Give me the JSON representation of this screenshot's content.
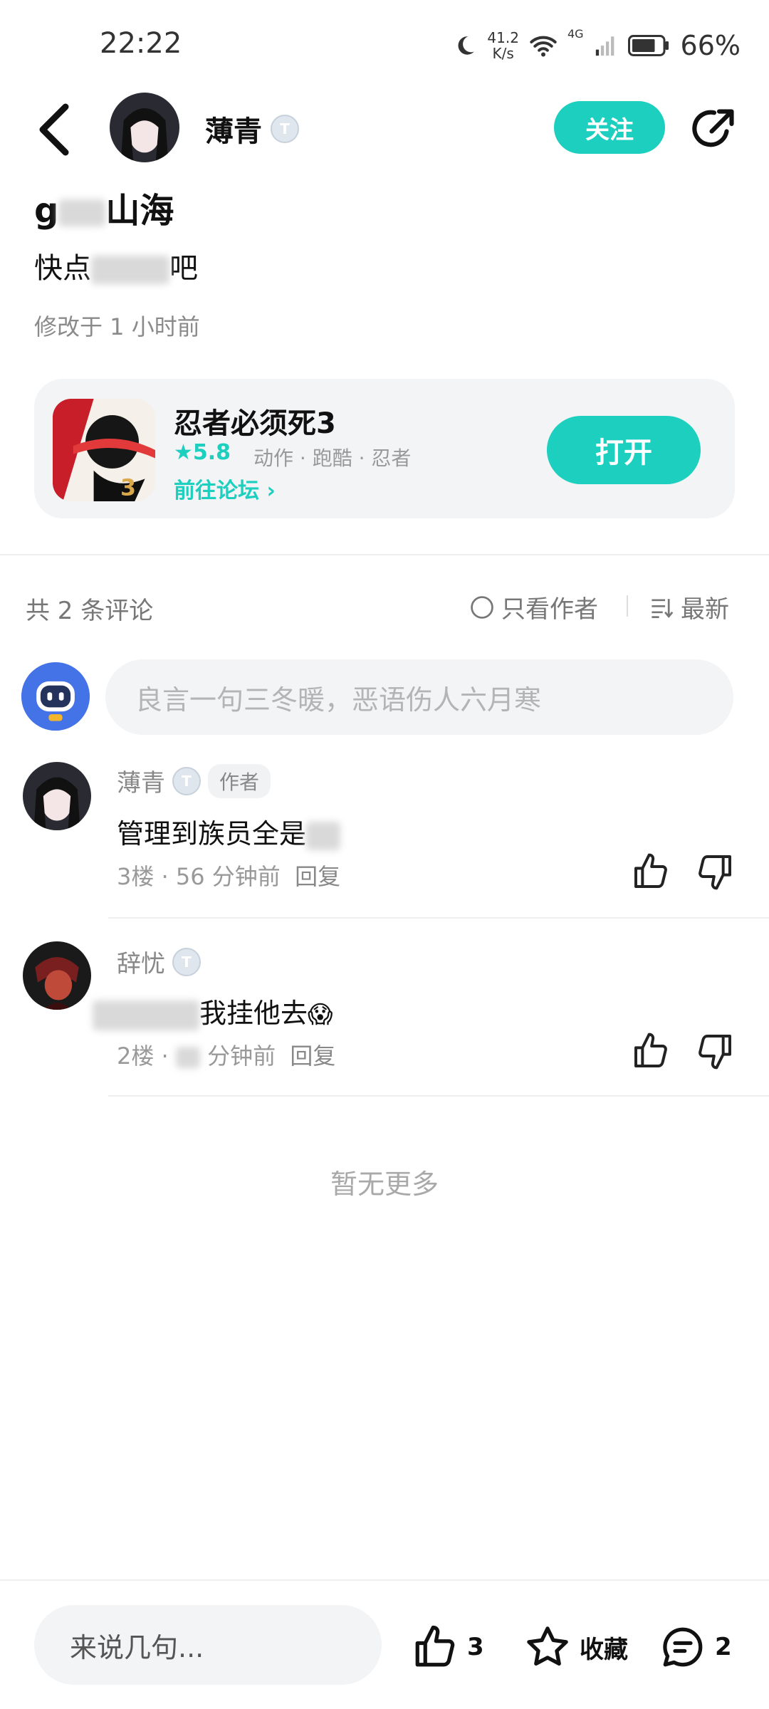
{
  "status_bar": {
    "time": "22:22",
    "net_speed_top": "41.2",
    "net_speed_bottom": "K/s",
    "signal": "4G",
    "battery": "66%"
  },
  "header": {
    "author_name": "薄青",
    "level_badge": "T",
    "follow_label": "关注"
  },
  "post": {
    "title_visible_prefix": "g",
    "title_visible_suffix": "山海",
    "body_visible_prefix": "快点",
    "body_visible_suffix": "吧",
    "modified": "修改于 1 小时前"
  },
  "game": {
    "name": "忍者必须死3",
    "score": "5.8",
    "tags": "动作 · 跑酷 · 忍者",
    "forum_link": "前往论坛",
    "open_label": "打开"
  },
  "comments_header": {
    "count": "共 2 条评论",
    "only_author": "只看作者",
    "sort": "最新"
  },
  "comment_input": {
    "placeholder": "良言一句三冬暖，恶语伤人六月寒"
  },
  "comments": [
    {
      "name": "薄青",
      "tag": "作者",
      "text": "管理到族员全是",
      "floor": "3楼",
      "time": "56 分钟前",
      "reply": "回复"
    },
    {
      "name": "辞忧",
      "tag": "",
      "text": "我挂他去",
      "emoji": "😱",
      "floor": "2楼",
      "time": "分钟前",
      "reply": "回复"
    }
  ],
  "no_more": "暂无更多",
  "bottom_bar": {
    "say_placeholder": "来说几句...",
    "likes": "3",
    "favorite_label": "收藏",
    "comments": "2"
  },
  "colors": {
    "accent": "#1ccfbe",
    "bg_gray": "#f3f4f6",
    "text_gray": "#888888"
  }
}
